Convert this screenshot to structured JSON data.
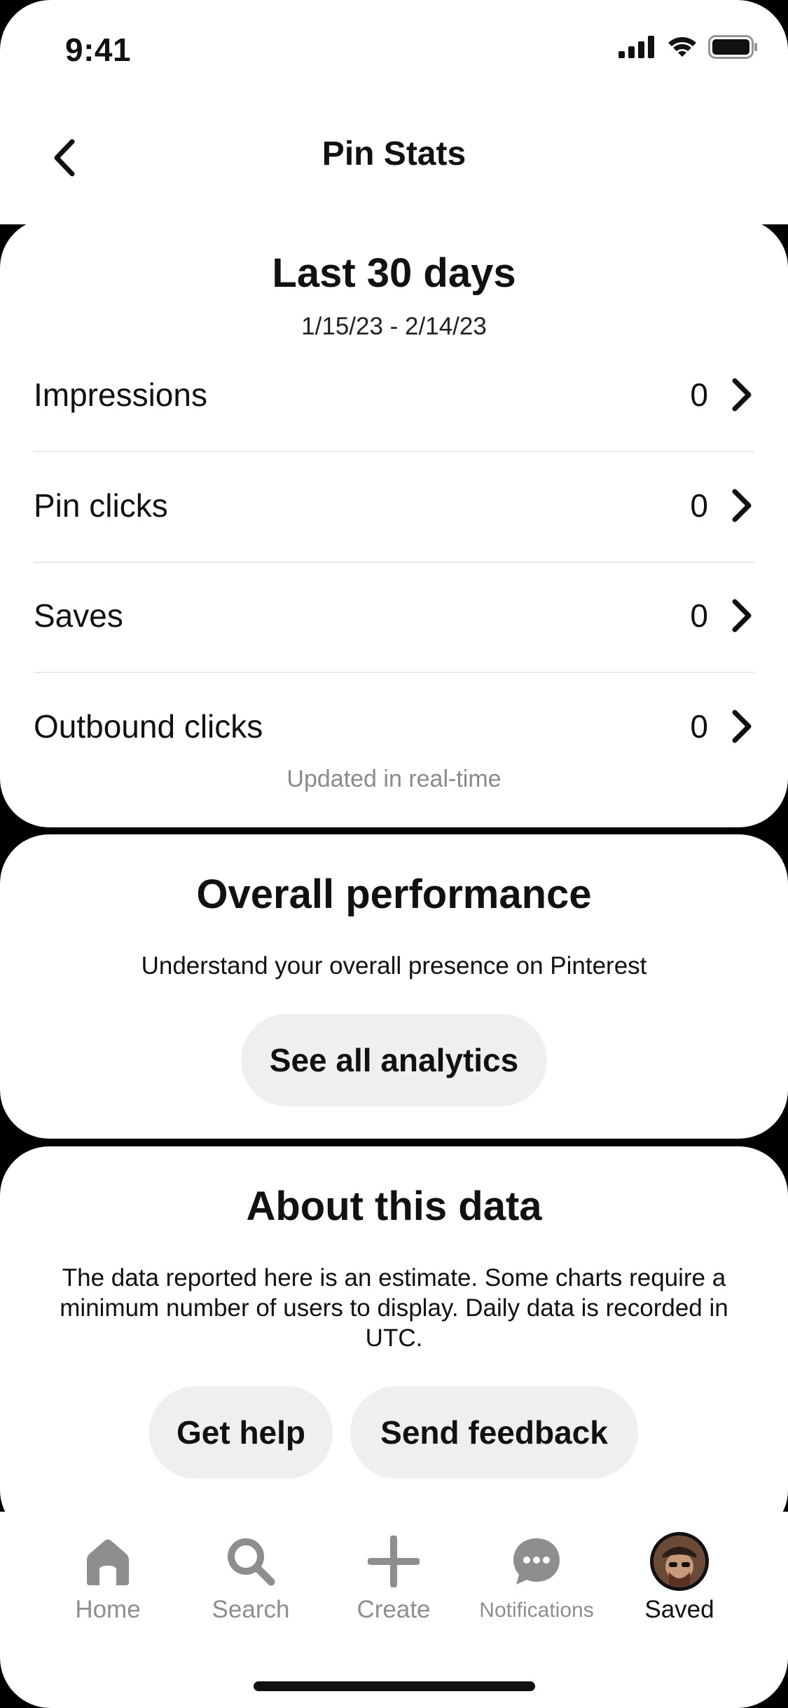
{
  "status_bar": {
    "time": "9:41"
  },
  "header": {
    "title": "Pin Stats"
  },
  "stats_card": {
    "title": "Last 30 days",
    "date_range": "1/15/23 - 2/14/23",
    "rows": [
      {
        "label": "Impressions",
        "value": "0"
      },
      {
        "label": "Pin clicks",
        "value": "0"
      },
      {
        "label": "Saves",
        "value": "0"
      },
      {
        "label": "Outbound clicks",
        "value": "0"
      }
    ],
    "footer": "Updated in real-time"
  },
  "performance_card": {
    "title": "Overall performance",
    "subtitle": "Understand your overall presence on Pinterest",
    "button": "See all analytics"
  },
  "about_card": {
    "title": "About this data",
    "body": "The data reported here is an estimate. Some charts require a minimum number of users to display. Daily data is recorded in UTC.",
    "help_button": "Get help",
    "feedback_button": "Send feedback"
  },
  "tab_bar": {
    "home": "Home",
    "search": "Search",
    "create": "Create",
    "notifications": "Notifications",
    "saved": "Saved",
    "active": "saved"
  },
  "colors": {
    "background": "#000000",
    "card": "#ffffff",
    "pill": "#efefef",
    "muted": "#8e8e8e"
  },
  "icons": [
    "back-chevron-icon",
    "chevron-right-icon",
    "home-icon",
    "search-icon",
    "plus-icon",
    "chat-bubble-icon",
    "avatar"
  ]
}
